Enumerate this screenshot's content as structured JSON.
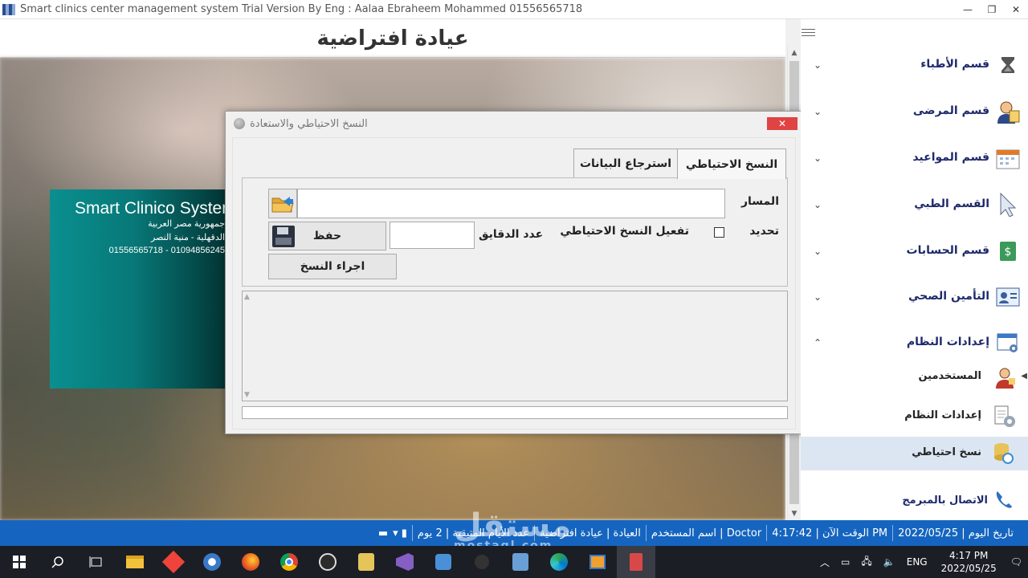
{
  "window": {
    "title": "Smart clinics center management system Trial Version By Eng : Aalaa Ebraheem Mohammed 01556565718",
    "minimize": "—",
    "restore": "❐",
    "close": "✕"
  },
  "header": {
    "clinic_name": "عيادة افتراضية"
  },
  "card": {
    "name": "Smart Clinico System",
    "line1": "جمهورية مصر العربية",
    "line2": "الدقهلية - منية النصر",
    "line3": "01556565718 - 01094856245"
  },
  "dialog": {
    "title": "النسخ الاحتياطي والاستعادة",
    "close": "✕",
    "tabs": [
      {
        "label": "النسخ الاحتياطي",
        "active": true
      },
      {
        "label": "استرجاع البيانات",
        "active": false
      }
    ],
    "path_label": "المسار",
    "path_value": "",
    "refresh_label": "تحديد",
    "auto_backup_label": "تفعيل النسخ الاحتياطي",
    "auto_backup_checked": false,
    "minutes_label": "عدد الدقايق",
    "minutes_value": "",
    "save_button": "حفظ",
    "run_button": "اجراء النسخ",
    "progress": 0
  },
  "sidebar": {
    "items": [
      {
        "label": "قسم الأطباء",
        "icon": "hourglass-icon"
      },
      {
        "label": "قسم المرضى",
        "icon": "patient-icon"
      },
      {
        "label": "قسم المواعيد",
        "icon": "calendar-icon"
      },
      {
        "label": "القسم الطبي",
        "icon": "cursor-icon"
      },
      {
        "label": "قسم الحسابات",
        "icon": "money-icon"
      },
      {
        "label": "التأمين الصحي",
        "icon": "id-card-icon"
      },
      {
        "label": "إعدادات النظام",
        "icon": "settings-window-icon",
        "expanded": true
      }
    ],
    "sub_items": [
      {
        "label": "المستخدمين",
        "icon": "users-icon",
        "selected": false
      },
      {
        "label": "إعدادات النظام",
        "icon": "gear-doc-icon",
        "selected": false
      },
      {
        "label": "نسخ احتياطي",
        "icon": "database-backup-icon",
        "selected": true
      }
    ],
    "contact": {
      "label": "الاتصال بالمبرمج",
      "icon": "phone-icon"
    }
  },
  "statusbar": {
    "date": "تاريخ اليوم | 2022/05/25",
    "time": "الوقت الآن | 4:17:42 PM",
    "user": "اسم المستخدم | Doctor",
    "clinic": "العيادة | عيادة افتراضية",
    "days_left": "عدد الأيام المتبقية | 2 يوم"
  },
  "taskbar": {
    "lang": "ENG",
    "time": "4:17 PM",
    "date": "2022/05/25"
  },
  "watermark": {
    "text": "مستقل",
    "sub": "mostaql.com"
  },
  "colors": {
    "statusbar": "#1565c0",
    "sidebar_text": "#1f2a6b",
    "close": "#e04343",
    "card": "#087878"
  }
}
